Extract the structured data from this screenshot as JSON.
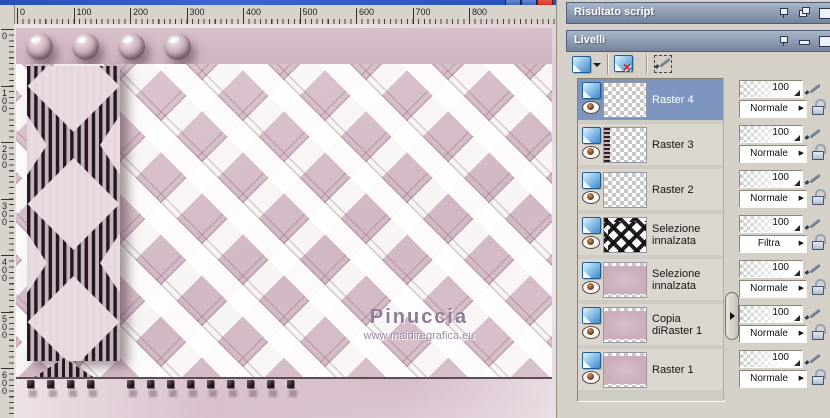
{
  "window": {
    "buttons": [
      "minimize-button",
      "maximize-button",
      "close-button"
    ]
  },
  "canvas": {
    "h_ruler_labels": [
      "0",
      "100",
      "200",
      "300",
      "400",
      "500",
      "600",
      "700",
      "800"
    ],
    "v_ruler_labels": [
      "0",
      "100",
      "200",
      "300",
      "400",
      "500",
      "600"
    ],
    "watermark_title": "Pinuccia",
    "watermark_url": "www.maidiregrafica.eu"
  },
  "panels": {
    "script_result": {
      "title": "Risultato script",
      "icons": [
        "pin-icon",
        "float-icon",
        "close-icon"
      ]
    },
    "layers": {
      "title": "Livelli",
      "icons": [
        "pin-icon",
        "collapse-icon",
        "close-icon"
      ],
      "toolbar": [
        {
          "name": "new-layer-button",
          "icon": "new-layer-icon"
        },
        {
          "name": "delete-layer-button",
          "icon": "delete-layer-icon"
        },
        {
          "name": "edit-selection-button",
          "icon": "edit-selection-icon"
        }
      ],
      "rows": [
        {
          "label": "Raster 4",
          "selected": true,
          "thumb": "checker",
          "opacity": "100",
          "blend": "Normale"
        },
        {
          "label": "Raster 3",
          "selected": false,
          "thumb": "checker-strip",
          "opacity": "100",
          "blend": "Normale"
        },
        {
          "label": "Raster 2",
          "selected": false,
          "thumb": "checker",
          "opacity": "100",
          "blend": "Normale"
        },
        {
          "label": "Selezione innalzata",
          "selected": false,
          "thumb": "weave-dark",
          "opacity": "100",
          "blend": "Filtra"
        },
        {
          "label": "Selezione innalzata",
          "selected": false,
          "thumb": "pink",
          "opacity": "100",
          "blend": "Normale"
        },
        {
          "label": "Copia diRaster 1",
          "selected": false,
          "thumb": "pink",
          "opacity": "100",
          "blend": "Normale"
        },
        {
          "label": "Raster 1",
          "selected": false,
          "thumb": "pink",
          "opacity": "100",
          "blend": "Normale"
        }
      ]
    }
  },
  "colors": {
    "selection_blue": "#7e96bf",
    "panel_titlebar_top": "#aab6c8",
    "panel_titlebar_bottom": "#74849c",
    "panel_gray": "#d5d1c9",
    "canvas_pink": "#eee2e8",
    "artwork_mauve": "#d2b8c5",
    "titlebar_blue": "#3a66d6",
    "close_red": "#d02818"
  }
}
